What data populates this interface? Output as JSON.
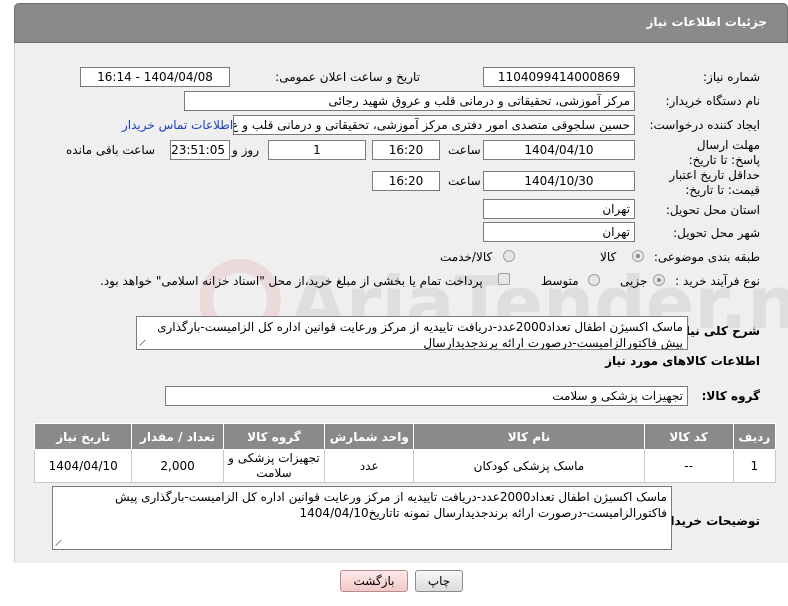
{
  "header": {
    "title": "جزئیات اطلاعات نیاز"
  },
  "form": {
    "need_number": {
      "label": "شماره نیاز:",
      "value": "1104099414000869"
    },
    "announce_date": {
      "label": "تاریخ و ساعت اعلان عمومی:",
      "value": "1404/04/08 - 16:14"
    },
    "buyer_org": {
      "label": "نام دستگاه خریدار:",
      "value": "مرکز آموزشی، تحقیقاتی و درمانی قلب و عروق شهید رجائی"
    },
    "requester": {
      "label": "ایجاد کننده درخواست:",
      "value": "حسین سلجوقی متصدی امور دفتری مرکز آموزشی، تحقیقاتی و درمانی قلب و ع",
      "contact_link": "اطلاعات تماس خریدار"
    },
    "reply_deadline": {
      "label": "مهلت ارسال پاسخ: تا تاریخ:",
      "date": "1404/04/10",
      "time_label": "ساعت",
      "time": "16:20",
      "days": "1",
      "days_label": "روز و",
      "remaining": "23:51:05",
      "remaining_label": "ساعت باقی مانده"
    },
    "price_validity": {
      "label": "حداقل تاریخ اعتبار قیمت: تا تاریخ:",
      "date": "1404/10/30",
      "time_label": "ساعت",
      "time": "16:20"
    },
    "province": {
      "label": "استان محل تحویل:",
      "value": "تهران"
    },
    "city": {
      "label": "شهر محل تحویل:",
      "value": "تهران"
    },
    "category": {
      "label": "طبقه بندی موضوعی:",
      "options": [
        "کالا",
        "کالا/خدمت"
      ]
    },
    "process": {
      "label": "نوع فرآیند خرید :",
      "options": [
        "جزیی",
        "متوسط"
      ],
      "payment_note": "پرداخت تمام یا بخشی از مبلغ خرید،از محل \"اسناد خزانه اسلامی\" خواهد بود."
    },
    "summary": {
      "label": "شرح کلی نیاز:",
      "value": "ماسک اکسیژن اطفال تعداد2000عدد-دریافت تاییدیه از مرکز ورعایت قوانین اداره کل الزامیست-بارگذاری پیش فاکتورالزامیست-درصورت ارائه برندجدیدارسال"
    }
  },
  "goods": {
    "section_title": "اطلاعات کالاهای مورد نیاز",
    "group_label": "گروه کالا:",
    "group_value": "تجهیزات پزشکی و سلامت",
    "columns": [
      "ردیف",
      "کد کالا",
      "نام کالا",
      "واحد شمارش",
      "گروه کالا",
      "تعداد / مقدار",
      "تاریخ نیاز"
    ],
    "rows": [
      {
        "row": "1",
        "code": "--",
        "name": "ماسک پزشکی کودکان",
        "unit": "عدد",
        "group": "تجهیزات پزشکی و سلامت",
        "qty": "2,000",
        "date": "1404/04/10"
      }
    ]
  },
  "buyer_notes": {
    "label": "توضیحات خریدار:",
    "value": "ماسک اکسیژن اطفال تعداد2000عدد-دریافت تاییدیه از مرکز ورعایت قوانین اداره کل الزامیست-بارگذاری پیش فاکتورالزامیست-درصورت ارائه برندجدیدارسال نمونه تاتاریخ1404/04/10"
  },
  "buttons": {
    "print": "چاپ",
    "back": "بازگشت"
  },
  "watermark": {
    "text": "AriaTender.net"
  }
}
